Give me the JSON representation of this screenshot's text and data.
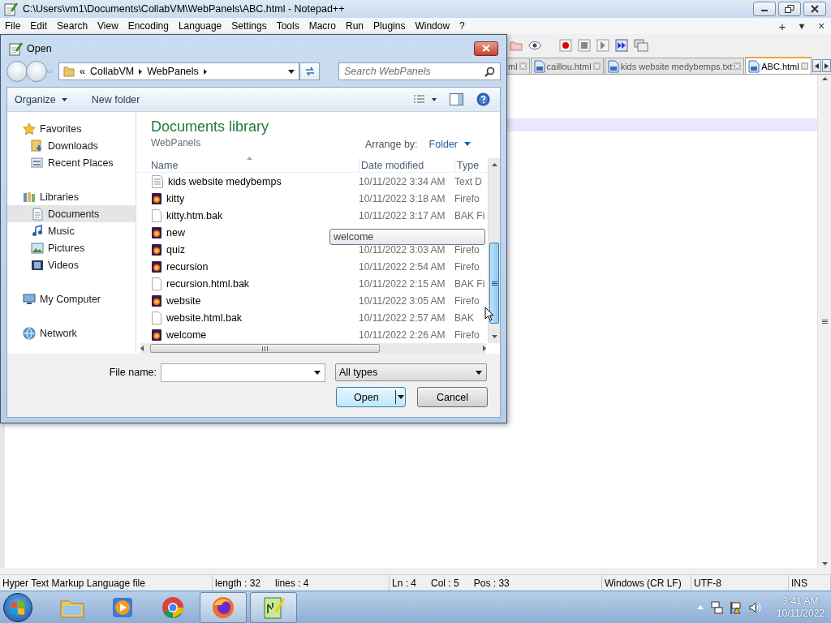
{
  "window": {
    "title": "C:\\Users\\vm1\\Documents\\CollabVM\\WebPanels\\ABC.html - Notepad++"
  },
  "menu": [
    "File",
    "Edit",
    "Search",
    "View",
    "Encoding",
    "Language",
    "Settings",
    "Tools",
    "Macro",
    "Run",
    "Plugins",
    "Window",
    "?"
  ],
  "menu_controls": [
    {
      "kind": "add",
      "label": "+"
    },
    {
      "kind": "list",
      "label": "▼"
    },
    {
      "kind": "close",
      "label": "×"
    }
  ],
  "tabs": [
    {
      "label": "ml",
      "selected": false,
      "partial": true
    },
    {
      "label": "caillou.html",
      "selected": false,
      "partial": false
    },
    {
      "label": "kids website medybemps.txt",
      "selected": false,
      "partial": false
    },
    {
      "label": "ABC.html",
      "selected": true,
      "partial": false
    }
  ],
  "dialog": {
    "title": "Open",
    "overflow_marker": "«",
    "breadcrumb": [
      "CollabVM",
      "WebPanels"
    ],
    "search": {
      "placeholder": "Search WebPanels"
    },
    "commands": [
      "Organize",
      "New folder"
    ],
    "nav": [
      {
        "label": "Favorites",
        "kind": "favorites",
        "selected": false,
        "children": [
          {
            "label": "Downloads",
            "kind": "downloads",
            "selected": false
          },
          {
            "label": "Recent Places",
            "kind": "recent",
            "selected": false
          }
        ]
      },
      {
        "label": "Libraries",
        "kind": "libraries",
        "selected": false,
        "children": [
          {
            "label": "Documents",
            "kind": "documents",
            "selected": true
          },
          {
            "label": "Music",
            "kind": "music",
            "selected": false
          },
          {
            "label": "Pictures",
            "kind": "pictures",
            "selected": false
          },
          {
            "label": "Videos",
            "kind": "videos",
            "selected": false
          }
        ]
      },
      {
        "label": "My Computer",
        "kind": "computer",
        "selected": false
      },
      {
        "label": "Network",
        "kind": "network",
        "selected": false
      }
    ],
    "library": {
      "title": "Documents library",
      "subtitle": "WebPanels",
      "arrange_label": "Arrange by:",
      "arrange_value": "Folder"
    },
    "columns": [
      "Name",
      "Date modified",
      "Type"
    ],
    "files": [
      {
        "name": "kids website medybemps",
        "kind": "text",
        "date": "10/11/2022 3:34 AM",
        "type": "Text D"
      },
      {
        "name": "kitty",
        "kind": "firefox",
        "date": "10/11/2022 3:18 AM",
        "type": "Firefo"
      },
      {
        "name": "kitty.htm.bak",
        "kind": "blank",
        "date": "10/11/2022 3:17 AM",
        "type": "BAK Fi"
      },
      {
        "name": "new",
        "kind": "firefox"
      },
      {
        "name": "quiz",
        "kind": "firefox",
        "date": "10/11/2022 3:03 AM",
        "type": "Firefo"
      },
      {
        "name": "recursion",
        "kind": "firefox",
        "date": "10/11/2022 2:54 AM",
        "type": "Firefo"
      },
      {
        "name": "recursion.html.bak",
        "kind": "blank",
        "date": "10/11/2022 2:15 AM",
        "type": "BAK Fi"
      },
      {
        "name": "website",
        "kind": "firefox",
        "date": "10/11/2022 3:05 AM",
        "type": "Firefo"
      },
      {
        "name": "website.html.bak",
        "kind": "blank",
        "date": "10/11/2022 2:57 AM",
        "type": "BAK"
      },
      {
        "name": "welcome",
        "kind": "firefox",
        "date": "10/11/2022 2:26 AM",
        "type": "Firefo"
      }
    ],
    "tooltip": "welcome",
    "file_name_label": "File name:",
    "file_type": "All types",
    "buttons": [
      {
        "label": "Open",
        "kind": "split"
      },
      {
        "label": "Cancel",
        "kind": "plain"
      }
    ]
  },
  "status_bar": [
    [
      "Hyper Text Markup Language file"
    ],
    [
      "length : 32",
      "lines : 4"
    ],
    [
      "Ln : 4",
      "Col : 5",
      "Pos : 33"
    ],
    [
      "Windows (CR LF)"
    ],
    [
      "UTF-8"
    ],
    [
      "INS"
    ]
  ],
  "taskbar": {
    "apps": [
      {
        "kind": "explorer",
        "active": false
      },
      {
        "kind": "media",
        "active": false
      },
      {
        "kind": "chrome",
        "active": false
      },
      {
        "kind": "firefox",
        "active": true
      },
      {
        "kind": "notepad",
        "active": true
      }
    ],
    "clock": {
      "time": "3:41 AM",
      "date": "10/11/2022"
    }
  }
}
